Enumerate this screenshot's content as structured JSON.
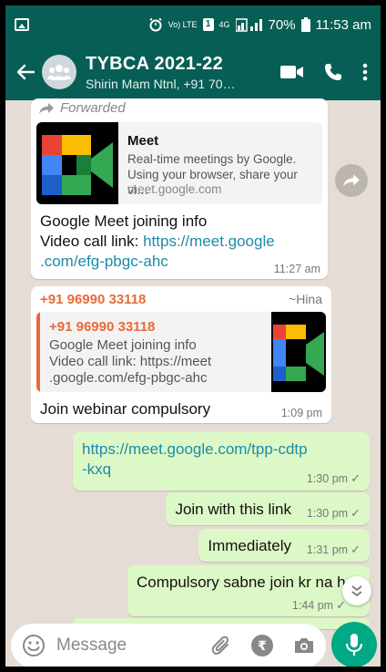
{
  "status_bar": {
    "volte": "Vo) LTE",
    "network": "4G",
    "battery": "70%",
    "time": "11:53 am"
  },
  "header": {
    "title": "TYBCA 2021-22",
    "subtitle": "Shirin Mam Ntnl, +91 70…"
  },
  "messages": {
    "m1": {
      "forwarded_label": "Forwarded",
      "preview_title": "Meet",
      "preview_desc": "Real-time meetings by Google. Using your browser, share your vi…",
      "preview_url": "meet.google.com",
      "text_line1": "Google Meet joining info",
      "text_prefix": "Video call link: ",
      "link_part1": "https://meet.google",
      "link_part2": ".com/efg-pbgc-ahc",
      "time": "11:27 am"
    },
    "m2": {
      "sender": "+91 96990 33118",
      "sender_name": "~Hina",
      "quote_sender": "+91 96990 33118",
      "quote_line1": "Google Meet joining info",
      "quote_line2": "Video call link: https://meet",
      "quote_line3": ".google.com/efg-pbgc-ahc",
      "text": "Join webinar compulsory",
      "time": "1:09 pm"
    },
    "m3": {
      "link_line1": "https://meet.google.com/tpp-cdtp",
      "link_line2": "-kxq",
      "time": "1:30 pm"
    },
    "m4": {
      "text": "Join with this link",
      "time": "1:30 pm"
    },
    "m5": {
      "text": "Immediately",
      "time": "1:31 pm"
    },
    "m6": {
      "text": "Compulsory sabne join kr na h",
      "time": "1:44 pm"
    }
  },
  "composer": {
    "placeholder": "Message",
    "currency_symbol": "₹"
  },
  "colors": {
    "header": "#075e54",
    "outgoing_bubble": "#dcf8c6",
    "incoming_bubble": "#ffffff",
    "chat_background": "#e5ddd5",
    "link": "#1d8ba8",
    "sender_orange": "#e86a38",
    "mic_button": "#00a884"
  }
}
